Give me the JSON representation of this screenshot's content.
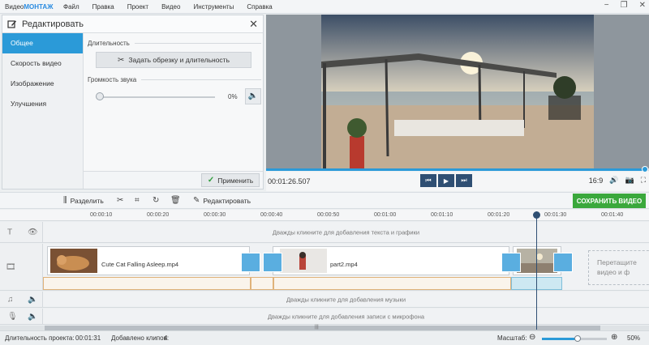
{
  "app": {
    "logo_prefix": "Видео",
    "logo_accent": "МОНТАЖ"
  },
  "menu": [
    "Файл",
    "Правка",
    "Проект",
    "Видео",
    "Инструменты",
    "Справка"
  ],
  "edit_panel": {
    "title": "Редактировать",
    "nav": [
      "Общее",
      "Скорость видео",
      "Изображение",
      "Улучшения"
    ],
    "active_nav": "Общее",
    "duration_label": "Длительность",
    "trim_button": "Задать обрезку и длительность",
    "volume_label": "Громкость звука",
    "volume_value": "0%",
    "volume_level": 0,
    "apply_button": "Применить"
  },
  "player": {
    "time": "00:01:26.507",
    "aspect": "16:9",
    "progress_fraction": 0.99
  },
  "toolbar": {
    "split": "Разделить",
    "edit": "Редактировать",
    "save": "СОХРАНИТЬ ВИДЕО"
  },
  "ruler": [
    "00:00:10",
    "00:00:20",
    "00:00:30",
    "00:00:40",
    "00:00:50",
    "00:01:00",
    "00:01:10",
    "00:01:20",
    "00:01:30",
    "00:01:40"
  ],
  "tracks": {
    "text_hint": "Дважды кликните для добавления текста и графики",
    "music_hint": "Дважды кликните для добавления музыки",
    "mic_hint": "Дважды кликните для добавления записи с микрофона",
    "clips": [
      "Cute Cat Falling Asleep.mp4",
      "part2.mp4"
    ],
    "transition_duration": "2.0",
    "drop_hint_line1": "Перетащите",
    "drop_hint_line2": "видео и ф"
  },
  "status": {
    "duration_label": "Длительность проекта:",
    "duration": "00:01:31",
    "clips_label": "Добавлено клипов:",
    "clips": "4",
    "zoom_label": "Масштаб:",
    "zoom": "50%",
    "zoom_level": 0.55
  },
  "colors": {
    "accent": "#2b9ad8",
    "save": "#3aa83c",
    "nav_dark": "#2f4f73"
  }
}
